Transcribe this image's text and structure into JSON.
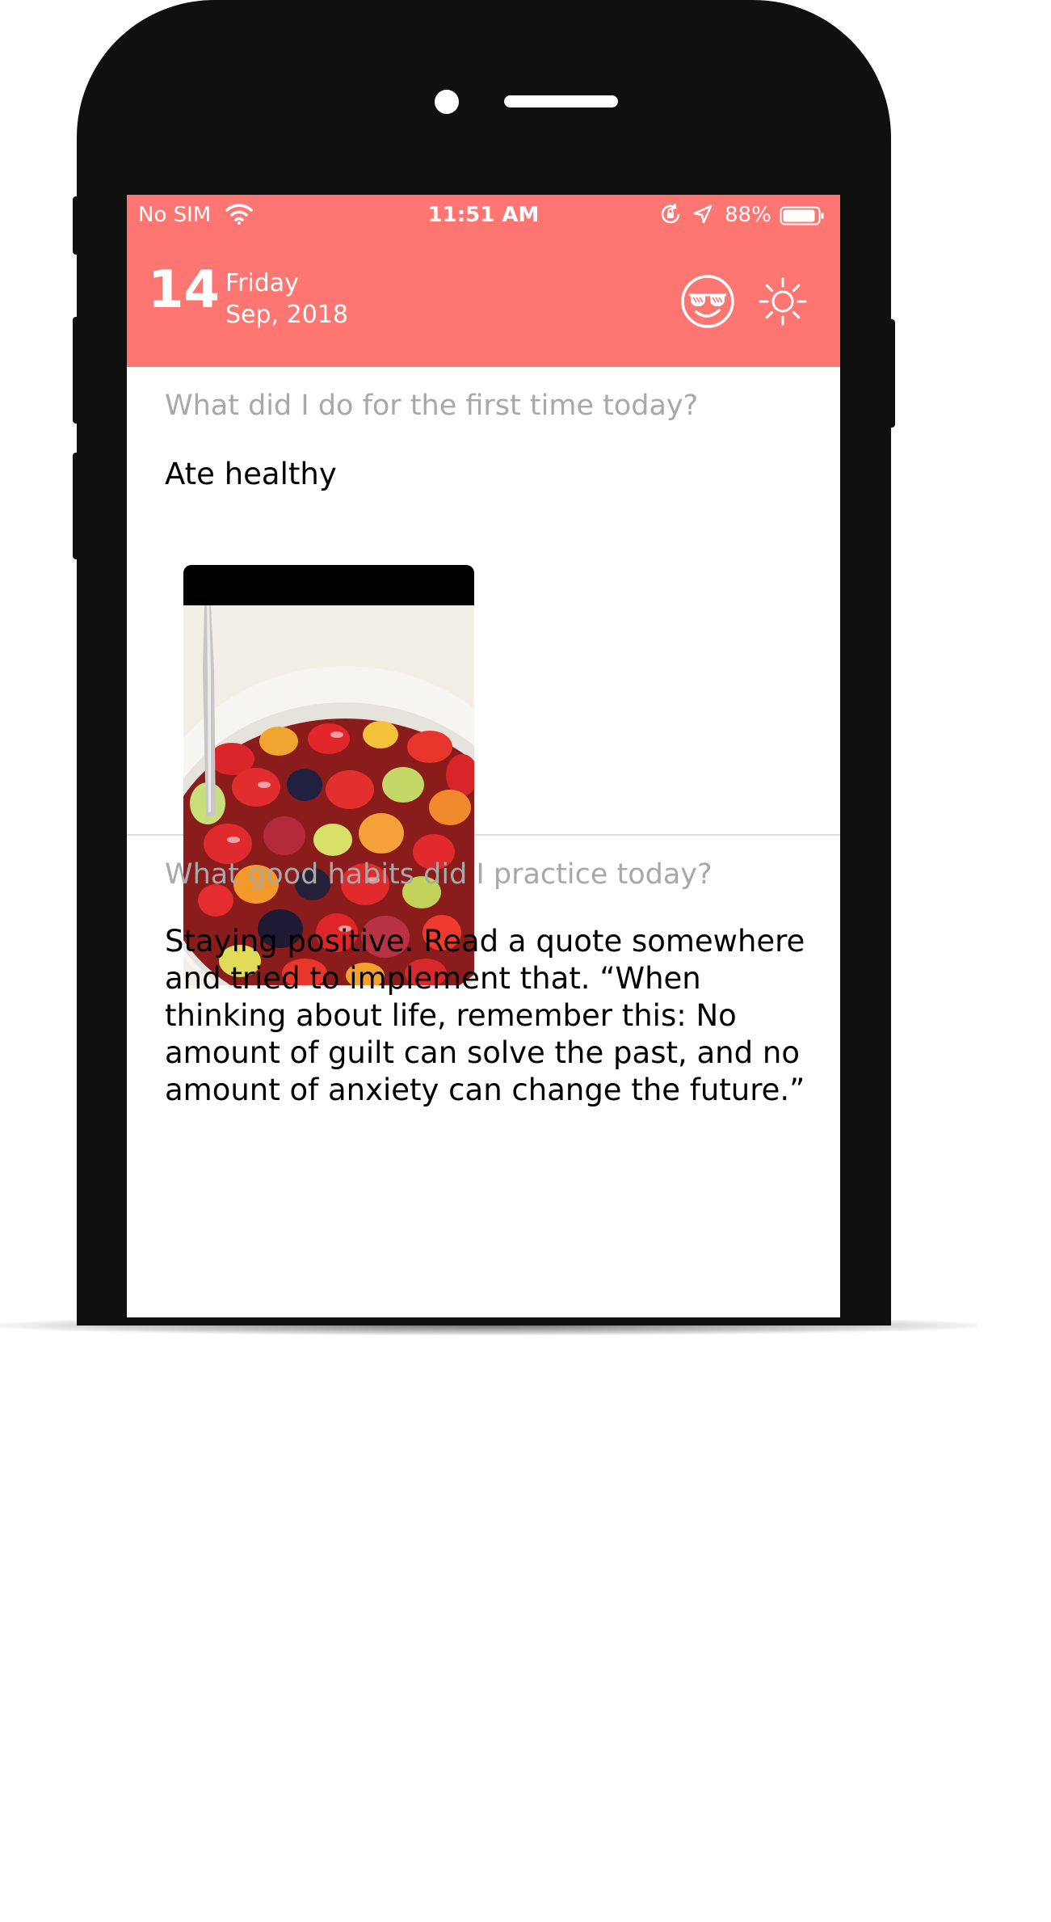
{
  "status_bar": {
    "carrier": "No SIM",
    "time": "11:51 AM",
    "battery": "88%"
  },
  "header": {
    "day_number": "14",
    "day_name": "Friday",
    "month_year": "Sep, 2018",
    "mood_icon": "sunglasses-smile-icon",
    "theme_icon": "sun-icon"
  },
  "entries": [
    {
      "question": "What did I do for the first time  today?",
      "answer": "Ate healthy",
      "photo": "fruit-salad-bowl"
    },
    {
      "question": "What good habits did I practice today?",
      "answer_lines": [
        "Staying positive. Read a quote somewhere",
        "and tried to implement that. “When",
        "thinking about life, remember this: No",
        "amount of guilt can solve the past, and no",
        "amount of anxiety can change the future.”"
      ]
    }
  ],
  "colors": {
    "header_bg": "#fd7672",
    "question_text": "#a8a8a8",
    "answer_text": "#000000",
    "phone_frame": "#101010"
  }
}
